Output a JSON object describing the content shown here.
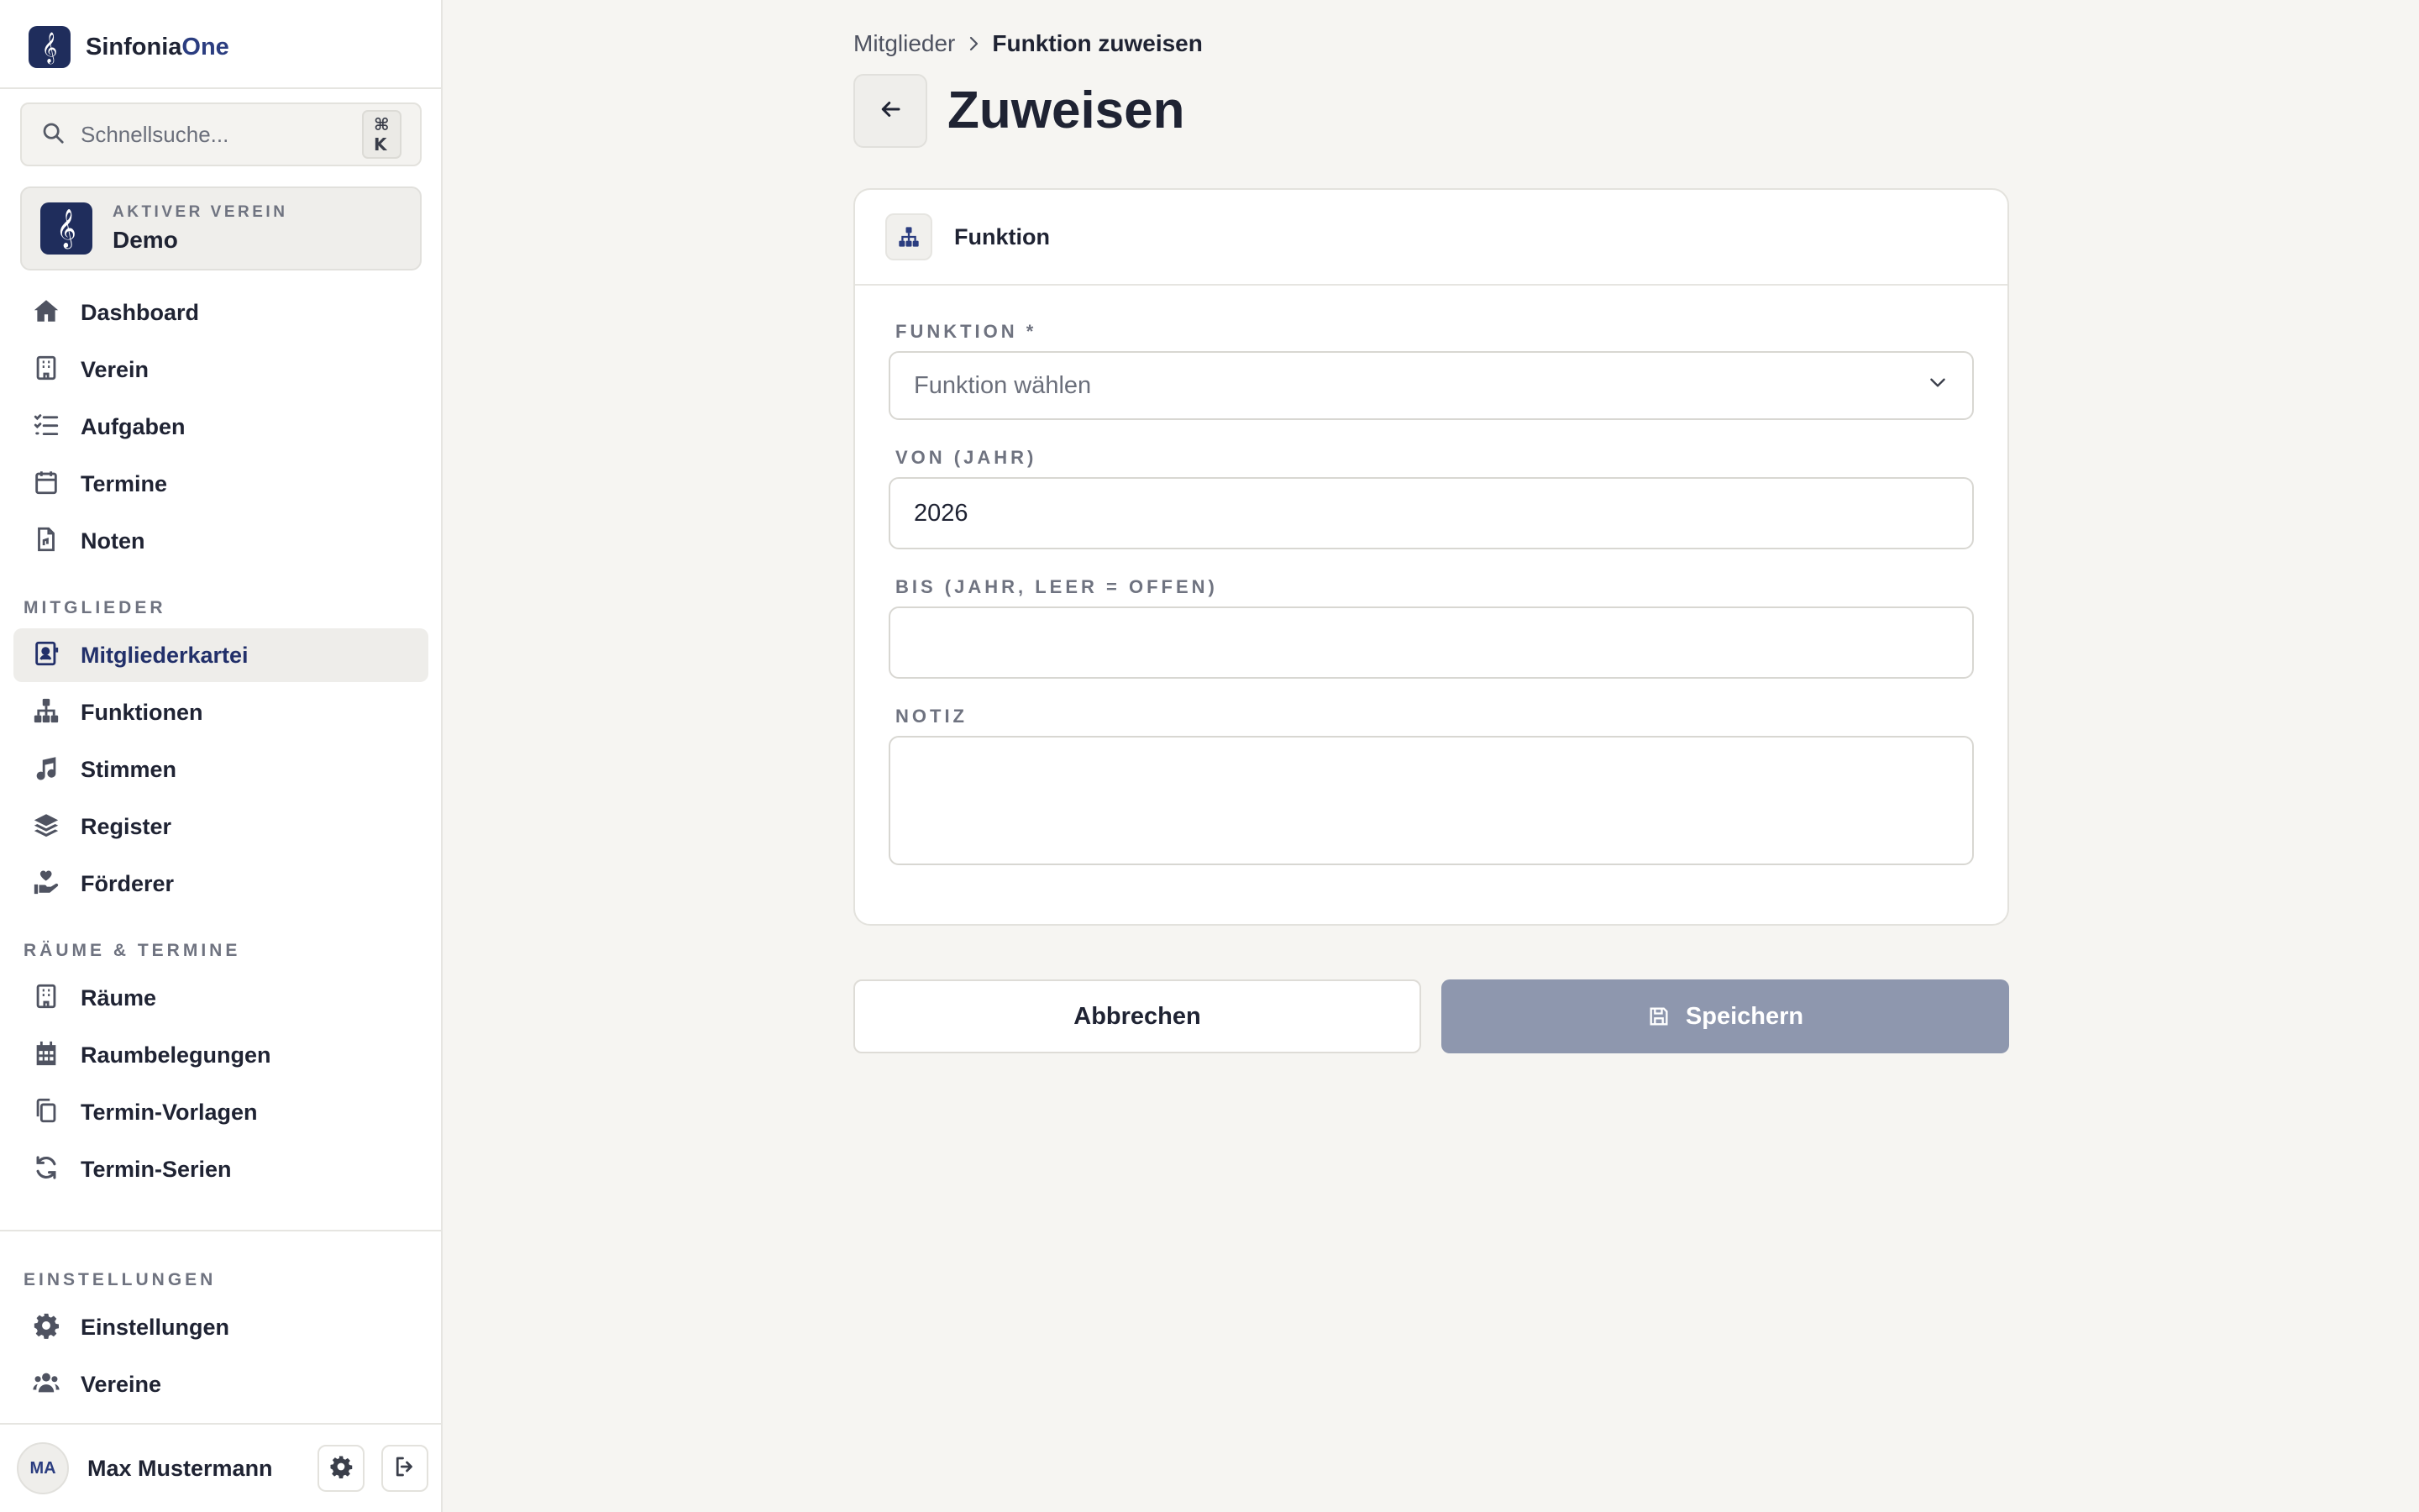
{
  "app": {
    "brand_main": "Sinfonia",
    "brand_accent": "One",
    "logo_glyph": "𝄞"
  },
  "search": {
    "placeholder": "Schnellsuche...",
    "shortcut": "⌘ K"
  },
  "club": {
    "label": "AKTIVER VEREIN",
    "name": "Demo",
    "logo_glyph": "𝄞"
  },
  "nav": {
    "main": [
      {
        "label": "Dashboard",
        "icon": "home-icon"
      },
      {
        "label": "Verein",
        "icon": "building-icon"
      },
      {
        "label": "Aufgaben",
        "icon": "list-check-icon"
      },
      {
        "label": "Termine",
        "icon": "calendar-icon"
      },
      {
        "label": "Noten",
        "icon": "sheet-file-icon"
      }
    ],
    "section_members": "MITGLIEDER",
    "members": [
      {
        "label": "Mitgliederkartei",
        "icon": "contact-card-icon",
        "active": true
      },
      {
        "label": "Funktionen",
        "icon": "hierarchy-icon"
      },
      {
        "label": "Stimmen",
        "icon": "music-note-icon"
      },
      {
        "label": "Register",
        "icon": "layers-icon"
      },
      {
        "label": "Förderer",
        "icon": "hand-heart-icon"
      }
    ],
    "section_rooms": "RÄUME & TERMINE",
    "rooms": [
      {
        "label": "Räume",
        "icon": "building-icon"
      },
      {
        "label": "Raumbelegungen",
        "icon": "calendar-grid-icon"
      },
      {
        "label": "Termin-Vorlagen",
        "icon": "copy-icon"
      },
      {
        "label": "Termin-Serien",
        "icon": "refresh-icon"
      }
    ],
    "section_settings": "EINSTELLUNGEN",
    "settings": [
      {
        "label": "Einstellungen",
        "icon": "gear-icon"
      },
      {
        "label": "Vereine",
        "icon": "users-icon"
      }
    ]
  },
  "user": {
    "initials": "MA",
    "name": "Max Mustermann"
  },
  "breadcrumb": {
    "parent": "Mitglieder",
    "current": "Funktion zuweisen"
  },
  "page": {
    "title": "Zuweisen"
  },
  "card": {
    "title": "Funktion"
  },
  "form": {
    "funktion_label": "FUNKTION *",
    "funktion_placeholder": "Funktion wählen",
    "von_label": "VON (JAHR)",
    "von_value": "2026",
    "bis_label": "BIS (JAHR, LEER = OFFEN)",
    "bis_value": "",
    "notiz_label": "NOTIZ",
    "notiz_value": ""
  },
  "actions": {
    "cancel": "Abbrechen",
    "save": "Speichern"
  },
  "colors": {
    "brand": "#1f2d5c",
    "accent": "#2b3d80",
    "save_disabled": "#8e97ae",
    "background": "#f6f5f2"
  }
}
